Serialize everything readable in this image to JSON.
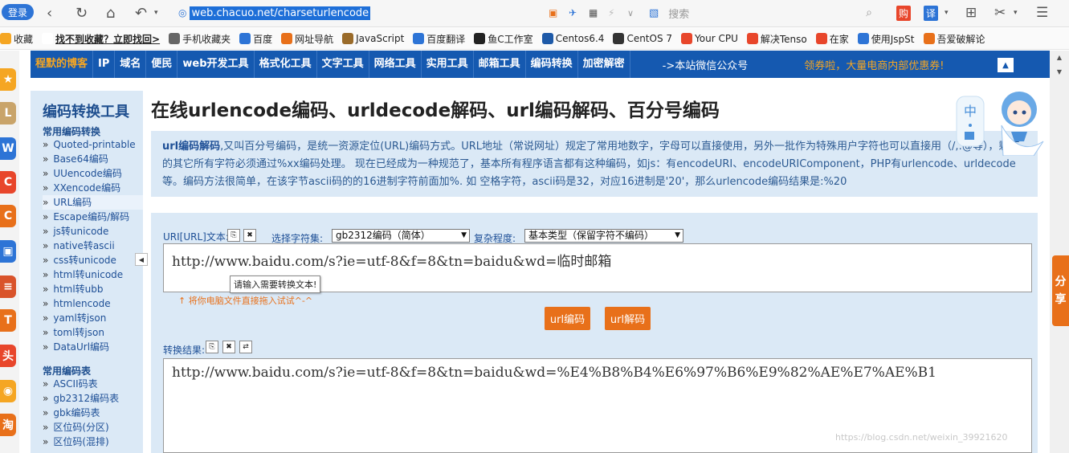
{
  "browser": {
    "login_label": "登录",
    "address": "web.chacuo.net/charseturlencode",
    "search_placeholder": "搜索",
    "buy_badge": "购",
    "translate_badge": "译"
  },
  "bookmarks": [
    {
      "label": "收藏",
      "color": "#f5a623"
    },
    {
      "label": "找不到收藏？立即找回>",
      "color": "#ffffff"
    },
    {
      "label": "手机收藏夹",
      "color": "#666666"
    },
    {
      "label": "百度",
      "color": "#2d74d6"
    },
    {
      "label": "网址导航",
      "color": "#e8701a"
    },
    {
      "label": "JavaScript",
      "color": "#9a6b2a"
    },
    {
      "label": "百度翻译",
      "color": "#2d74d6"
    },
    {
      "label": "鱼C工作室",
      "color": "#222222"
    },
    {
      "label": "Centos6.4",
      "color": "#1e5aa8"
    },
    {
      "label": "CentOS 7",
      "color": "#333333"
    },
    {
      "label": "Your CPU",
      "color": "#e8462b"
    },
    {
      "label": "解决Tenso",
      "color": "#e8462b"
    },
    {
      "label": "在家",
      "color": "#e8462b"
    },
    {
      "label": "使用JspSt",
      "color": "#2d74d6"
    },
    {
      "label": "吾爱破解论",
      "color": "#e8701a"
    }
  ],
  "nav": {
    "items": [
      "程默的博客",
      "IP",
      "域名",
      "便民",
      "web开发工具",
      "格式化工具",
      "文字工具",
      "网络工具",
      "实用工具",
      "邮箱工具",
      "编码转换",
      "加密解密"
    ],
    "wechat": "->本站微信公众号",
    "promo": "领券啦，大量电商内部优惠券!"
  },
  "panel": {
    "title": "编码转换工具",
    "section1": "常用编码转换",
    "links1": [
      "Quoted-printable",
      "Base64编码",
      "UUencode编码",
      "XXencode编码",
      "URL编码",
      "Escape编码/解码",
      "js转unicode",
      "native转ascii",
      "css转unicode",
      "html转unicode",
      "html转ubb",
      "htmlencode",
      "yaml转json",
      "toml转json",
      "DataUrl编码"
    ],
    "section2": "常用编码表",
    "links2": [
      "ASCII码表",
      "gb2312编码表",
      "gbk编码表",
      "区位码(分区)",
      "区位码(混排)"
    ]
  },
  "page": {
    "title": "在线urlencode编码、urldecode解码、url编码解码、百分号编码",
    "desc_bold": "url编码解码",
    "desc_rest": ",又叫百分号编码，是统一资源定位(URL)编码方式。URL地址（常说网址）规定了常用地数字，字母可以直接使用，另外一批作为特殊用户字符也可以直接用（/,:@等），剩下的其它所有字符必须通过%xx编码处理。 现在已经成为一种规范了，基本所有程序语言都有这种编码，如js：有encodeURI、encodeURIComponent，PHP有urlencode、urldecode等。编码方法很简单，在该字节ascii码的的16进制字符前面加%. 如 空格字符，ascii码是32，对应16进制是'20'，那么urlencode编码结果是:%20"
  },
  "tool": {
    "input_label": "URI[URL]文本:",
    "charset_label": "选择字符集:",
    "charset_value": "gb2312编码（简体）",
    "complexity_label": "复杂程度:",
    "complexity_value": "基本类型（保留字符不编码）",
    "input_text": "http://www.baidu.com/s?ie=utf-8&f=8&tn=baidu&wd=临时邮箱",
    "tooltip": "请输入需要转换文本!",
    "drag_hint": "↑ 将你电脑文件直接拖入试试^-^",
    "encode_btn": "url编码",
    "decode_btn": "url解码",
    "result_label": "转换结果:",
    "result_text": "http://www.baidu.com/s?ie=utf-8&f=8&tn=baidu&wd=%E4%B8%B4%E6%97%B6%E9%82%AE%E7%AE%B1"
  },
  "misc": {
    "share": [
      "分",
      "享"
    ],
    "mascot_text": "中",
    "watermark": "https://blog.csdn.net/weixin_39921620"
  }
}
